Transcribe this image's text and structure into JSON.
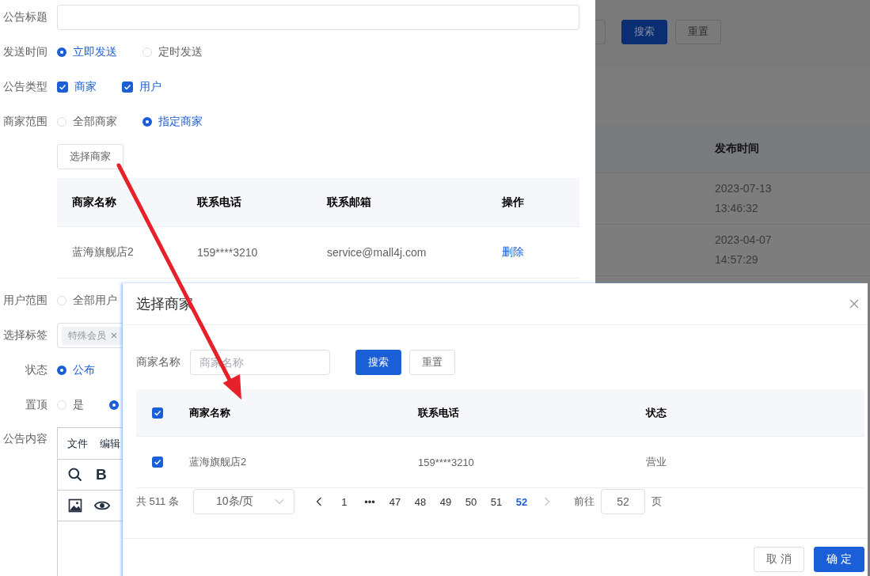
{
  "form": {
    "rows": [
      {
        "kind": "input",
        "label": "公告标题"
      },
      {
        "kind": "radio",
        "label": "发送时间",
        "options": [
          {
            "label": "立即发送",
            "selected": true
          },
          {
            "label": "定时发送",
            "selected": false
          }
        ]
      },
      {
        "kind": "checkbox",
        "label": "公告类型",
        "options": [
          {
            "label": "商家",
            "checked": true
          },
          {
            "label": "用户",
            "checked": true
          }
        ]
      },
      {
        "kind": "radio",
        "label": "商家范围",
        "options": [
          {
            "label": "全部商家",
            "selected": false
          },
          {
            "label": "指定商家",
            "selected": true
          }
        ]
      },
      {
        "kind": "button",
        "text": "选择商家"
      },
      {
        "kind": "table",
        "columns": [
          "商家名称",
          "联系电话",
          "联系邮箱",
          "操作"
        ],
        "rows": [
          {
            "cells": [
              "蓝海旗舰店2",
              "159****3210",
              "service@mall4j.com"
            ],
            "action": "删除"
          }
        ]
      },
      {
        "kind": "radio",
        "label": "用户范围",
        "options": [
          {
            "label": "全部用户",
            "selected": false
          }
        ]
      },
      {
        "kind": "tags",
        "label": "选择标签",
        "tags": [
          "特殊会员"
        ]
      },
      {
        "kind": "radio",
        "label": "状态",
        "options": [
          {
            "label": "公布",
            "selected": true
          }
        ]
      },
      {
        "kind": "radio",
        "label": "置顶",
        "options": [
          {
            "label": "是",
            "selected": false
          },
          {
            "selected": true
          }
        ]
      },
      {
        "kind": "editor",
        "label": "公告内容",
        "menus": [
          "文件",
          "编辑"
        ],
        "bold": "B"
      }
    ]
  },
  "background_page": {
    "buttons": [
      {
        "label": "搜索",
        "kind": "primary"
      },
      {
        "label": "重置",
        "kind": "default"
      }
    ],
    "table": {
      "column": "发布时间",
      "rows": [
        "2023-07-13 13:46:32",
        "2023-04-07 14:57:29"
      ]
    }
  },
  "dialog": {
    "title": "选择商家",
    "search": {
      "label": "商家名称",
      "placeholder": "商家名称",
      "buttons": [
        {
          "label": "搜索",
          "kind": "primary"
        },
        {
          "label": "重置",
          "kind": "default"
        }
      ]
    },
    "table": {
      "all_checked": true,
      "columns": [
        "商家名称",
        "联系电话",
        "状态"
      ],
      "rows": [
        {
          "checked": true,
          "cells": [
            "蓝海旗舰店2",
            "159****3210",
            "营业"
          ]
        }
      ]
    },
    "pagination": {
      "total": "共 511 条",
      "page_size": "10条/页",
      "prev_disabled": false,
      "next_disabled": true,
      "pages": [
        {
          "label": "1",
          "selected": false
        },
        {
          "label": "•••",
          "selected": false
        },
        {
          "label": "47",
          "selected": false
        },
        {
          "label": "48",
          "selected": false
        },
        {
          "label": "49",
          "selected": false
        },
        {
          "label": "50",
          "selected": false
        },
        {
          "label": "51",
          "selected": false
        },
        {
          "label": "52",
          "selected": true
        }
      ],
      "goto_label": "前往",
      "goto_value": "52",
      "page_unit": "页"
    },
    "footer_buttons": [
      {
        "label": "取 消",
        "kind": "default"
      },
      {
        "label": "确 定",
        "kind": "primary"
      }
    ]
  }
}
